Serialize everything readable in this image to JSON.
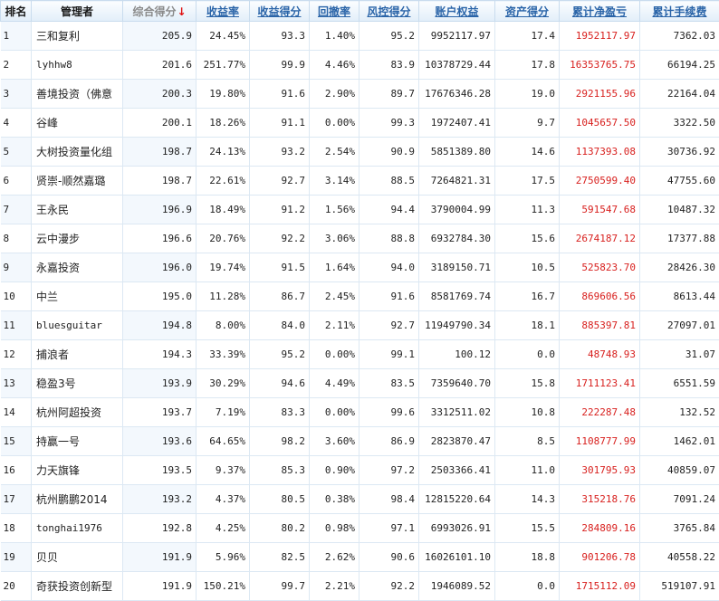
{
  "table": {
    "headers": {
      "rank": "排名",
      "manager": "管理者",
      "score": "综合得分",
      "return_rate": "收益率",
      "return_score": "收益得分",
      "drawdown": "回撤率",
      "risk_score": "风控得分",
      "equity": "账户权益",
      "asset_score": "资产得分",
      "net_profit": "累计净盈亏",
      "fees": "累计手续费"
    },
    "sort_indicator": "↓",
    "rows": [
      {
        "rank": "1",
        "manager": "三和复利",
        "score": "205.9",
        "return_rate": "24.45%",
        "return_score": "93.3",
        "drawdown": "1.40%",
        "risk_score": "95.2",
        "equity": "9952117.97",
        "asset_score": "17.4",
        "net_profit": "1952117.97",
        "fees": "7362.03"
      },
      {
        "rank": "2",
        "manager": "lyhhw8",
        "score": "201.6",
        "return_rate": "251.77%",
        "return_score": "99.9",
        "drawdown": "4.46%",
        "risk_score": "83.9",
        "equity": "10378729.44",
        "asset_score": "17.8",
        "net_profit": "16353765.75",
        "fees": "66194.25"
      },
      {
        "rank": "3",
        "manager": "善境投资（佛意",
        "score": "200.3",
        "return_rate": "19.80%",
        "return_score": "91.6",
        "drawdown": "2.90%",
        "risk_score": "89.7",
        "equity": "17676346.28",
        "asset_score": "19.0",
        "net_profit": "2921155.96",
        "fees": "22164.04"
      },
      {
        "rank": "4",
        "manager": "谷峰",
        "score": "200.1",
        "return_rate": "18.26%",
        "return_score": "91.1",
        "drawdown": "0.00%",
        "risk_score": "99.3",
        "equity": "1972407.41",
        "asset_score": "9.7",
        "net_profit": "1045657.50",
        "fees": "3322.50"
      },
      {
        "rank": "5",
        "manager": "大树投资量化组",
        "score": "198.7",
        "return_rate": "24.13%",
        "return_score": "93.2",
        "drawdown": "2.54%",
        "risk_score": "90.9",
        "equity": "5851389.80",
        "asset_score": "14.6",
        "net_profit": "1137393.08",
        "fees": "30736.92"
      },
      {
        "rank": "6",
        "manager": "贤崇-顺然嘉璐",
        "score": "198.7",
        "return_rate": "22.61%",
        "return_score": "92.7",
        "drawdown": "3.14%",
        "risk_score": "88.5",
        "equity": "7264821.31",
        "asset_score": "17.5",
        "net_profit": "2750599.40",
        "fees": "47755.60"
      },
      {
        "rank": "7",
        "manager": "王永民",
        "score": "196.9",
        "return_rate": "18.49%",
        "return_score": "91.2",
        "drawdown": "1.56%",
        "risk_score": "94.4",
        "equity": "3790004.99",
        "asset_score": "11.3",
        "net_profit": "591547.68",
        "fees": "10487.32"
      },
      {
        "rank": "8",
        "manager": "云中漫步",
        "score": "196.6",
        "return_rate": "20.76%",
        "return_score": "92.2",
        "drawdown": "3.06%",
        "risk_score": "88.8",
        "equity": "6932784.30",
        "asset_score": "15.6",
        "net_profit": "2674187.12",
        "fees": "17377.88"
      },
      {
        "rank": "9",
        "manager": "永嘉投资",
        "score": "196.0",
        "return_rate": "19.74%",
        "return_score": "91.5",
        "drawdown": "1.64%",
        "risk_score": "94.0",
        "equity": "3189150.71",
        "asset_score": "10.5",
        "net_profit": "525823.70",
        "fees": "28426.30"
      },
      {
        "rank": "10",
        "manager": "中兰",
        "score": "195.0",
        "return_rate": "11.28%",
        "return_score": "86.7",
        "drawdown": "2.45%",
        "risk_score": "91.6",
        "equity": "8581769.74",
        "asset_score": "16.7",
        "net_profit": "869606.56",
        "fees": "8613.44"
      },
      {
        "rank": "11",
        "manager": "bluesguitar",
        "score": "194.8",
        "return_rate": "8.00%",
        "return_score": "84.0",
        "drawdown": "2.11%",
        "risk_score": "92.7",
        "equity": "11949790.34",
        "asset_score": "18.1",
        "net_profit": "885397.81",
        "fees": "27097.01"
      },
      {
        "rank": "12",
        "manager": "捕浪者",
        "score": "194.3",
        "return_rate": "33.39%",
        "return_score": "95.2",
        "drawdown": "0.00%",
        "risk_score": "99.1",
        "equity": "100.12",
        "asset_score": "0.0",
        "net_profit": "48748.93",
        "fees": "31.07"
      },
      {
        "rank": "13",
        "manager": "稳盈3号",
        "score": "193.9",
        "return_rate": "30.29%",
        "return_score": "94.6",
        "drawdown": "4.49%",
        "risk_score": "83.5",
        "equity": "7359640.70",
        "asset_score": "15.8",
        "net_profit": "1711123.41",
        "fees": "6551.59"
      },
      {
        "rank": "14",
        "manager": "杭州阿超投资",
        "score": "193.7",
        "return_rate": "7.19%",
        "return_score": "83.3",
        "drawdown": "0.00%",
        "risk_score": "99.6",
        "equity": "3312511.02",
        "asset_score": "10.8",
        "net_profit": "222287.48",
        "fees": "132.52"
      },
      {
        "rank": "15",
        "manager": "持赢一号",
        "score": "193.6",
        "return_rate": "64.65%",
        "return_score": "98.2",
        "drawdown": "3.60%",
        "risk_score": "86.9",
        "equity": "2823870.47",
        "asset_score": "8.5",
        "net_profit": "1108777.99",
        "fees": "1462.01"
      },
      {
        "rank": "16",
        "manager": "力天旗锋",
        "score": "193.5",
        "return_rate": "9.37%",
        "return_score": "85.3",
        "drawdown": "0.90%",
        "risk_score": "97.2",
        "equity": "2503366.41",
        "asset_score": "11.0",
        "net_profit": "301795.93",
        "fees": "40859.07"
      },
      {
        "rank": "17",
        "manager": "杭州鹏鹏2014",
        "score": "193.2",
        "return_rate": "4.37%",
        "return_score": "80.5",
        "drawdown": "0.38%",
        "risk_score": "98.4",
        "equity": "12815220.64",
        "asset_score": "14.3",
        "net_profit": "315218.76",
        "fees": "7091.24"
      },
      {
        "rank": "18",
        "manager": "tonghai1976",
        "score": "192.8",
        "return_rate": "4.25%",
        "return_score": "80.2",
        "drawdown": "0.98%",
        "risk_score": "97.1",
        "equity": "6993026.91",
        "asset_score": "15.5",
        "net_profit": "284809.16",
        "fees": "3765.84"
      },
      {
        "rank": "19",
        "manager": "贝贝",
        "score": "191.9",
        "return_rate": "5.96%",
        "return_score": "82.5",
        "drawdown": "2.62%",
        "risk_score": "90.6",
        "equity": "16026101.10",
        "asset_score": "18.8",
        "net_profit": "901206.78",
        "fees": "40558.22"
      },
      {
        "rank": "20",
        "manager": "奇获投资创新型",
        "score": "191.9",
        "return_rate": "150.21%",
        "return_score": "99.7",
        "drawdown": "2.21%",
        "risk_score": "92.2",
        "equity": "1946089.52",
        "asset_score": "0.0",
        "net_profit": "1715112.09",
        "fees": "519107.91"
      }
    ]
  }
}
